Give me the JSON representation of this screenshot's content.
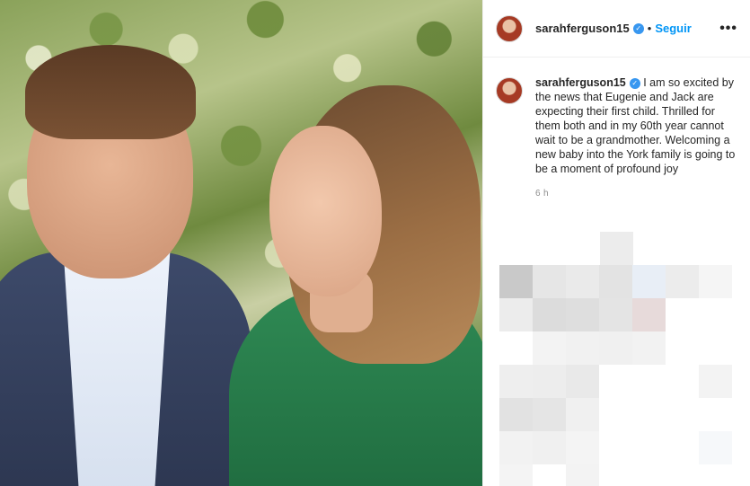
{
  "post": {
    "username": "sarahferguson15",
    "verified_icon": "verified-badge-icon",
    "separator": "•",
    "follow_label": "Seguir",
    "more_label": "•••",
    "caption": "I am so excited by the news that Eugenie and Jack are expecting their first child. Thrilled for them both and in my 60th year cannot wait to be a grandmother. Welcoming a new baby into the York family is going to be a moment of profound joy",
    "time": "6 h"
  },
  "colors": {
    "follow": "#0095f6",
    "verified": "#3897f0",
    "timestamp": "#8e8e8e"
  }
}
